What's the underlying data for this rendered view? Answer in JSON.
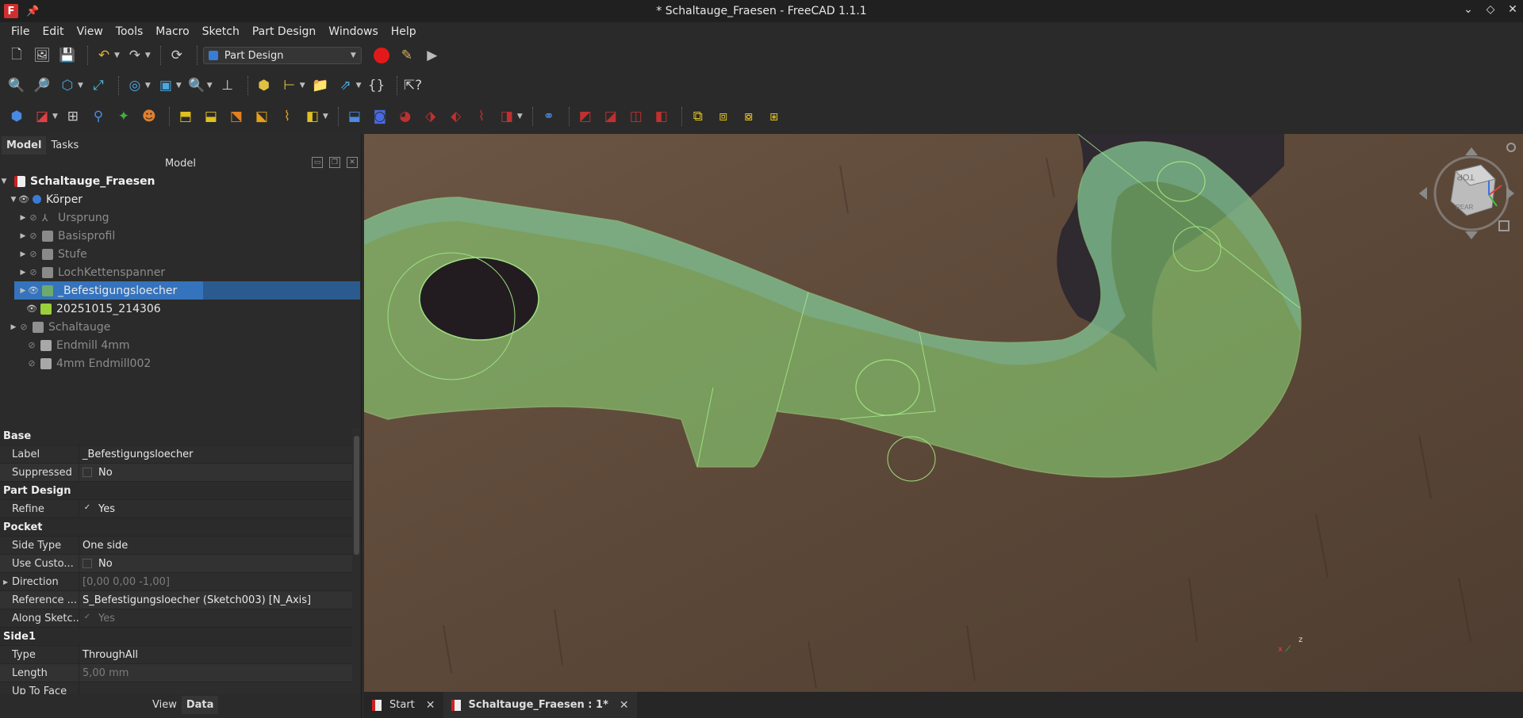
{
  "window": {
    "title": "* Schaltauge_Fraesen - FreeCAD 1.1.1",
    "app_icon_letter": "F",
    "controls": [
      "⌄",
      "◇",
      "✕"
    ]
  },
  "menu": [
    "File",
    "Edit",
    "View",
    "Tools",
    "Macro",
    "Sketch",
    "Part Design",
    "Windows",
    "Help"
  ],
  "toolbar": {
    "workbench": "Part Design"
  },
  "panel": {
    "tabs": [
      "Model",
      "Tasks"
    ],
    "header": "Model"
  },
  "tree": [
    {
      "label": "Schaltauge_Fraesen",
      "style": "bold",
      "icon": "document-icon"
    },
    {
      "label": "Körper",
      "style": "normal",
      "icon": "body-icon"
    },
    {
      "label": "Ursprung",
      "style": "dim",
      "icon": "origin-icon"
    },
    {
      "label": "Basisprofil",
      "style": "dim",
      "icon": "pad-icon"
    },
    {
      "label": "Stufe",
      "style": "dim",
      "icon": "pad-icon"
    },
    {
      "label": "LochKettenspanner",
      "style": "dim",
      "icon": "pad-icon"
    },
    {
      "label": "_Befestigungsloecher",
      "style": "normal",
      "icon": "pocket-icon"
    },
    {
      "label": "20251015_214306",
      "style": "normal",
      "icon": "sketch-icon"
    },
    {
      "label": "Schaltauge",
      "style": "dim",
      "icon": "part-icon"
    },
    {
      "label": "Endmill 4mm",
      "style": "dim",
      "icon": "endmill-icon"
    },
    {
      "label": "4mm Endmill002",
      "style": "dim",
      "icon": "endmill-icon"
    }
  ],
  "properties": {
    "groups": {
      "base": "Base",
      "part_design": "Part Design",
      "pocket": "Pocket",
      "side1": "Side1"
    },
    "label": {
      "name": "Label",
      "value": "_Befestigungsloecher"
    },
    "suppressed": {
      "name": "Suppressed",
      "value": "No"
    },
    "refine": {
      "name": "Refine",
      "value": "Yes"
    },
    "side_type": {
      "name": "Side Type",
      "value": "One side"
    },
    "use_custom": {
      "name": "Use Custo...",
      "value": "No"
    },
    "direction": {
      "name": "Direction",
      "value": "[0,00 0,00 -1,00]"
    },
    "reference": {
      "name": "Reference ...",
      "value": "S_Befestigungsloecher (Sketch003) [N_Axis]"
    },
    "along_sketch": {
      "name": "Along Sketc...",
      "value": "Yes"
    },
    "type": {
      "name": "Type",
      "value": "ThroughAll"
    },
    "length": {
      "name": "Length",
      "value": "5,00 mm"
    },
    "up_to_face": {
      "name": "Up To Face",
      "value": ""
    }
  },
  "bottom_tabs": [
    "View",
    "Data"
  ],
  "doc_tabs": [
    {
      "label": "Start"
    },
    {
      "label": "Schaltauge_Fraesen : 1*"
    }
  ],
  "navcube": {
    "face": "TOP",
    "side": "REAR"
  },
  "axes": {
    "x": "x",
    "z": "z"
  },
  "colors": {
    "selection": "#3573bd",
    "model_green": "#8fe07a",
    "wood": "#5a4638"
  }
}
